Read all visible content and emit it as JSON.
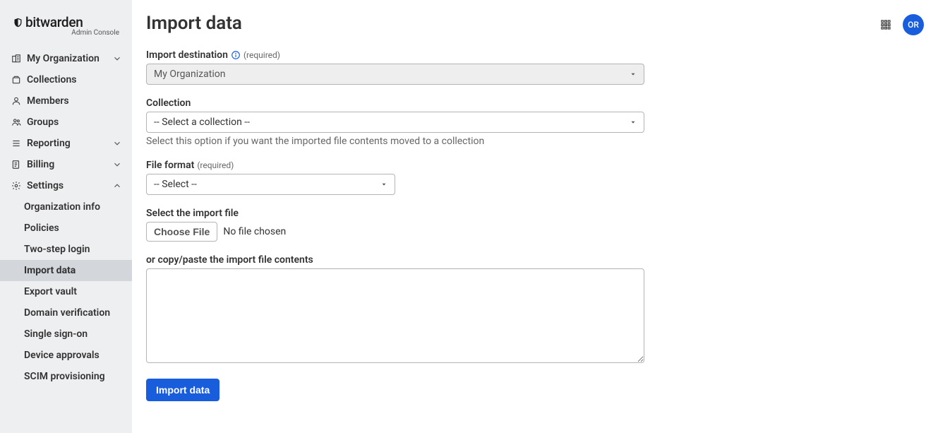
{
  "brand": {
    "name": "bitwarden",
    "subtitle": "Admin Console"
  },
  "sidebar": {
    "items": [
      {
        "label": "My Organization",
        "icon": "org",
        "chevron": "down"
      },
      {
        "label": "Collections",
        "icon": "collection"
      },
      {
        "label": "Members",
        "icon": "member"
      },
      {
        "label": "Groups",
        "icon": "group"
      },
      {
        "label": "Reporting",
        "icon": "reporting",
        "chevron": "down"
      },
      {
        "label": "Billing",
        "icon": "billing",
        "chevron": "down"
      },
      {
        "label": "Settings",
        "icon": "settings",
        "chevron": "up"
      }
    ],
    "settings_sub": [
      {
        "label": "Organization info"
      },
      {
        "label": "Policies"
      },
      {
        "label": "Two-step login"
      },
      {
        "label": "Import data",
        "active": true
      },
      {
        "label": "Export vault"
      },
      {
        "label": "Domain verification"
      },
      {
        "label": "Single sign-on"
      },
      {
        "label": "Device approvals"
      },
      {
        "label": "SCIM provisioning"
      }
    ]
  },
  "header": {
    "avatar_initials": "OR"
  },
  "page": {
    "title": "Import data",
    "required_label": "(required)",
    "fields": {
      "destination": {
        "label": "Import destination",
        "value": "My Organization"
      },
      "collection": {
        "label": "Collection",
        "value": "-- Select a collection --",
        "hint": "Select this option if you want the imported file contents moved to a collection"
      },
      "format": {
        "label": "File format",
        "value": "-- Select --"
      },
      "file": {
        "label": "Select the import file",
        "button": "Choose File",
        "status": "No file chosen"
      },
      "paste": {
        "label": "or copy/paste the import file contents",
        "value": ""
      }
    },
    "submit_label": "Import data"
  }
}
